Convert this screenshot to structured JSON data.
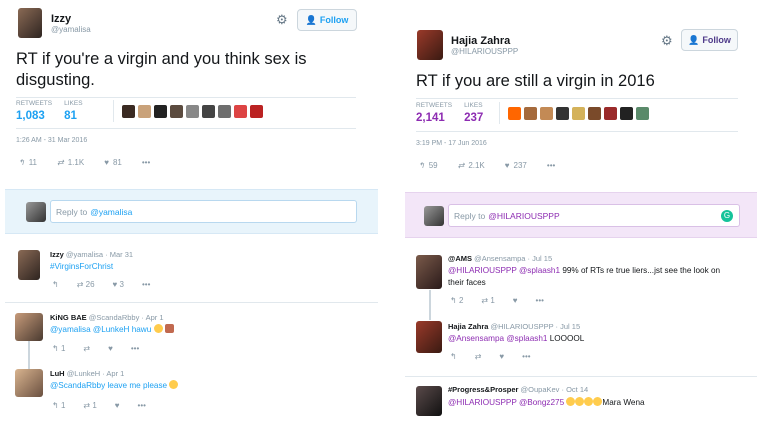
{
  "left": {
    "tweet": {
      "name": "Izzy",
      "handle": "@yamalisa",
      "follow_label": "Follow",
      "text": "RT if you're a virgin and you think sex is disgusting.",
      "retweets_label": "RETWEETS",
      "retweets": "1,083",
      "likes_label": "LIKES",
      "likes": "81",
      "timestamp": "1:26 AM - 31 Mar 2016",
      "action_reply": "11",
      "action_retweet": "1.1K",
      "action_like": "81"
    },
    "reply_box": {
      "prefix": "Reply to",
      "mention": "@yamalisa"
    },
    "replies": [
      {
        "name": "Izzy",
        "handle": "@yamalisa · Mar 31",
        "text": "#VirginsForChrist",
        "retweets": "26",
        "likes": "3"
      },
      {
        "name": "KiNG BAE",
        "handle": "@ScandaRbby · Apr 1",
        "text": "@yamalisa @LunkeH hawu",
        "replies": "1"
      },
      {
        "name": "LuH",
        "handle": "@LunkeH · Apr 1",
        "text": "@ScandaRbby leave me please",
        "replies": "1",
        "retweets": "1"
      }
    ]
  },
  "right": {
    "tweet": {
      "name": "Hajia Zahra",
      "handle": "@HILARIOUSPPP",
      "follow_label": "Follow",
      "text": "RT if you are still a virgin in 2016",
      "retweets_label": "RETWEETS",
      "retweets": "2,141",
      "likes_label": "LIKES",
      "likes": "237",
      "timestamp": "3:19 PM - 17 Jun 2016",
      "action_reply": "59",
      "action_retweet": "2.1K",
      "action_like": "237"
    },
    "reply_box": {
      "prefix": "Reply to",
      "mention": "@HILARIOUSPPP"
    },
    "replies": [
      {
        "name": "@AMS",
        "handle": "@Ansensampa · Jul 15",
        "mentions": "@HILARIOUSPPP @splaash1",
        "text": " 99% of RTs re true liers...jst see the look on their faces",
        "replies": "2",
        "retweets": "1"
      },
      {
        "name": "Hajia Zahra",
        "handle": "@HILARIOUSPPP · Jul 15",
        "mentions": "@Ansensampa @splaash1",
        "text": " LOOOOL"
      },
      {
        "name": "#Progress&Prosper",
        "handle": "@OupaKev · Oct 14",
        "mentions": "@HILARIOUSPPP @Bongz275",
        "text": "Mara Wena"
      }
    ]
  },
  "colors": {
    "accent_blue": "#1da1f2",
    "accent_purple": "#8d2cb2",
    "reply_bg_left": "#e8f4fb",
    "reply_bg_right": "#f3e6f8"
  }
}
